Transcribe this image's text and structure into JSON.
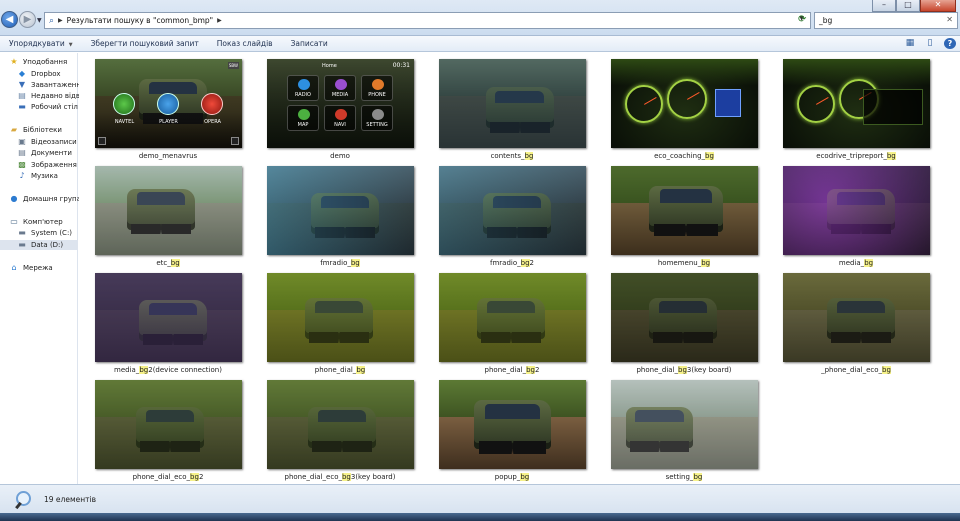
{
  "address_bar": {
    "path": "Результати пошуку в \"common_bmp\"",
    "search_value": "_bg"
  },
  "toolbar": {
    "organize": "Упорядкувати",
    "save_search": "Зберегти пошуковий запит",
    "slideshow": "Показ слайдів",
    "burn": "Записати"
  },
  "sidebar": {
    "favorites": "Уподобання",
    "dropbox": "Dropbox",
    "downloads": "Завантаження",
    "recent": "Недавно відві",
    "desktop": "Робочий стіл",
    "libraries": "Бібліотеки",
    "videos": "Відеозаписи",
    "documents": "Документи",
    "pictures": "Зображення",
    "music": "Музика",
    "homegroup": "Домашня група",
    "computer": "Комп'ютер",
    "drive_c": "System (C:)",
    "drive_d": "Data (D:)",
    "network": "Мережа"
  },
  "files": [
    {
      "pre": "demo_menavrus",
      "hl": "",
      "post": ""
    },
    {
      "pre": "demo",
      "hl": "",
      "post": ""
    },
    {
      "pre": "contents_",
      "hl": "bg",
      "post": ""
    },
    {
      "pre": "eco_coaching_",
      "hl": "bg",
      "post": ""
    },
    {
      "pre": "ecodrive_tripreport_",
      "hl": "bg",
      "post": ""
    },
    {
      "pre": "etc_",
      "hl": "bg",
      "post": ""
    },
    {
      "pre": "fmradio_",
      "hl": "bg",
      "post": ""
    },
    {
      "pre": "fmradio_",
      "hl": "bg",
      "post": "2"
    },
    {
      "pre": "homemenu_",
      "hl": "bg",
      "post": ""
    },
    {
      "pre": "media_",
      "hl": "bg",
      "post": ""
    },
    {
      "pre": "media_",
      "hl": "bg",
      "post": "2(device connection)"
    },
    {
      "pre": "phone_dial_",
      "hl": "bg",
      "post": ""
    },
    {
      "pre": "phone_dial_",
      "hl": "bg",
      "post": "2"
    },
    {
      "pre": "phone_dial_",
      "hl": "bg",
      "post": "3(key board)"
    },
    {
      "pre": "_phone_dial_eco_",
      "hl": "bg",
      "post": ""
    },
    {
      "pre": "phone_dial_eco_",
      "hl": "bg",
      "post": "2"
    },
    {
      "pre": "phone_dial_eco_",
      "hl": "bg",
      "post": "3(key board)"
    },
    {
      "pre": "popup_",
      "hl": "bg",
      "post": ""
    },
    {
      "pre": "setting_",
      "hl": "bg",
      "post": ""
    }
  ],
  "thumb_text": {
    "menavrus_navtel": "NAVTEL",
    "menavrus_player": "PLAYER",
    "menavrus_opera": "OPERA",
    "menavrus_corner": "SBW",
    "demo_home": "Home",
    "demo_time": "00:31",
    "demo_radio": "RADIO",
    "demo_media": "MEDIA",
    "demo_phone": "PHONE",
    "demo_map": "MAP",
    "demo_navi": "NAVI",
    "demo_setting": "SETTING"
  },
  "status": {
    "count_text": "19 елементів"
  }
}
